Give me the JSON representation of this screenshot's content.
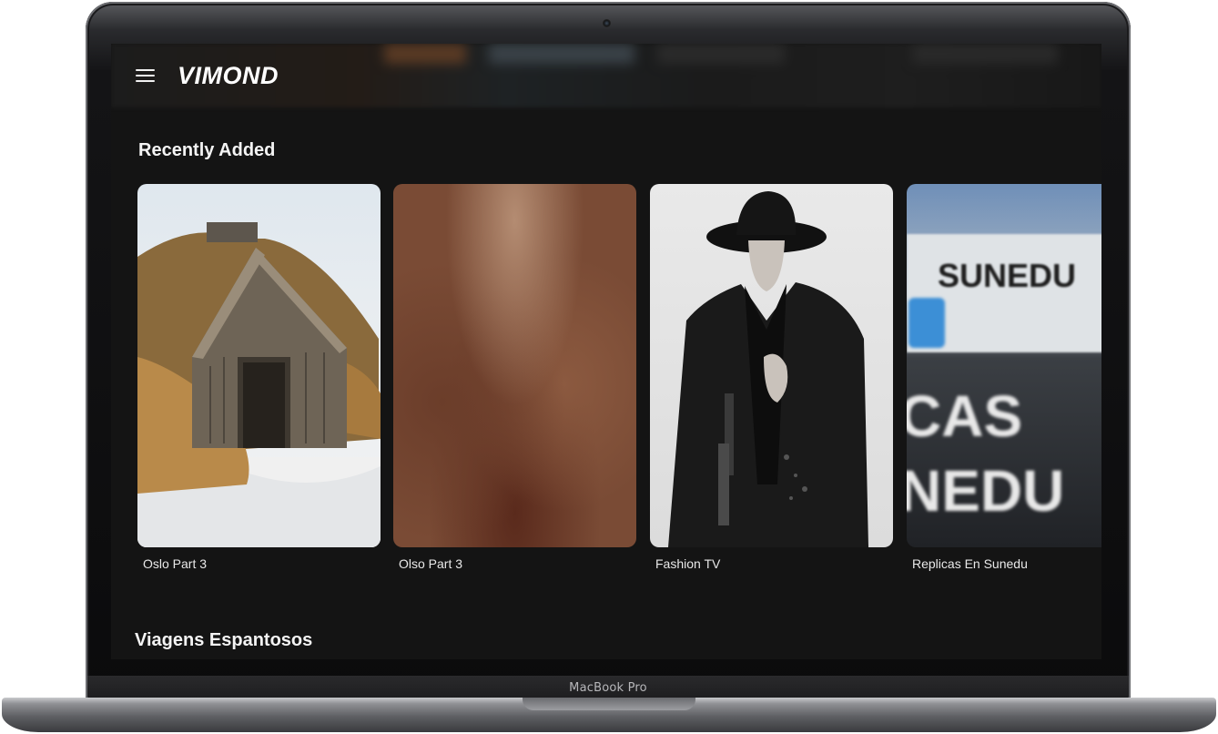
{
  "device": {
    "label": "MacBook Pro"
  },
  "app": {
    "brand": "VIMOND"
  },
  "sections": [
    {
      "title": "Recently Added",
      "items": [
        {
          "title": "Oslo Part 3",
          "thumbnail": "wooden-barn-in-snow"
        },
        {
          "title": "Olso Part 3",
          "thumbnail": "blurred-brown-image"
        },
        {
          "title": "Fashion TV",
          "thumbnail": "man-in-black-hat-and-coat"
        },
        {
          "title": "Replicas En Sunedu",
          "thumbnail": "sunedu-building-sign",
          "overlay_lines": [
            "SUNEDU",
            "CAS",
            "NEDU"
          ]
        }
      ]
    },
    {
      "title": "Viagens Espantosos"
    }
  ],
  "colors": {
    "background": "#141414",
    "text": "#f4f4f4",
    "card_title": "#e9e9e9"
  },
  "icons": {
    "menu": "hamburger-menu-icon",
    "camera": "webcam-icon"
  }
}
